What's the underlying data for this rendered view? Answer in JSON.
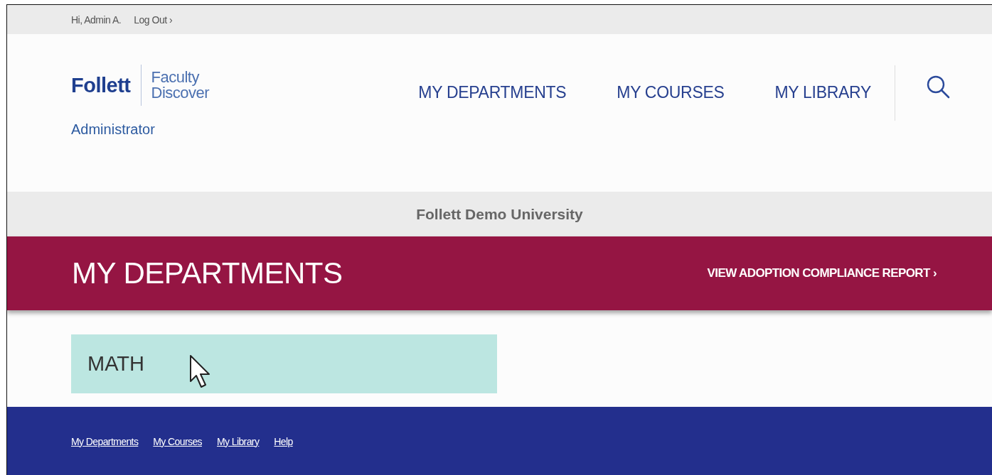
{
  "top_bar": {
    "greeting": "Hi, Admin A.",
    "logout": "Log Out ›"
  },
  "header": {
    "logo": {
      "brand": "Follett",
      "product_line1": "Faculty",
      "product_line2": "Discover"
    },
    "role": "Administrator",
    "nav": [
      {
        "label": "MY DEPARTMENTS"
      },
      {
        "label": "MY COURSES"
      },
      {
        "label": "MY LIBRARY"
      }
    ]
  },
  "institution": "Follett Demo University",
  "banner": {
    "title": "MY DEPARTMENTS",
    "action": "VIEW ADOPTION COMPLIANCE REPORT ›"
  },
  "departments": [
    {
      "name": "MATH"
    }
  ],
  "footer": {
    "links": [
      "My Departments",
      "My Courses",
      "My Library",
      "Help"
    ]
  }
}
